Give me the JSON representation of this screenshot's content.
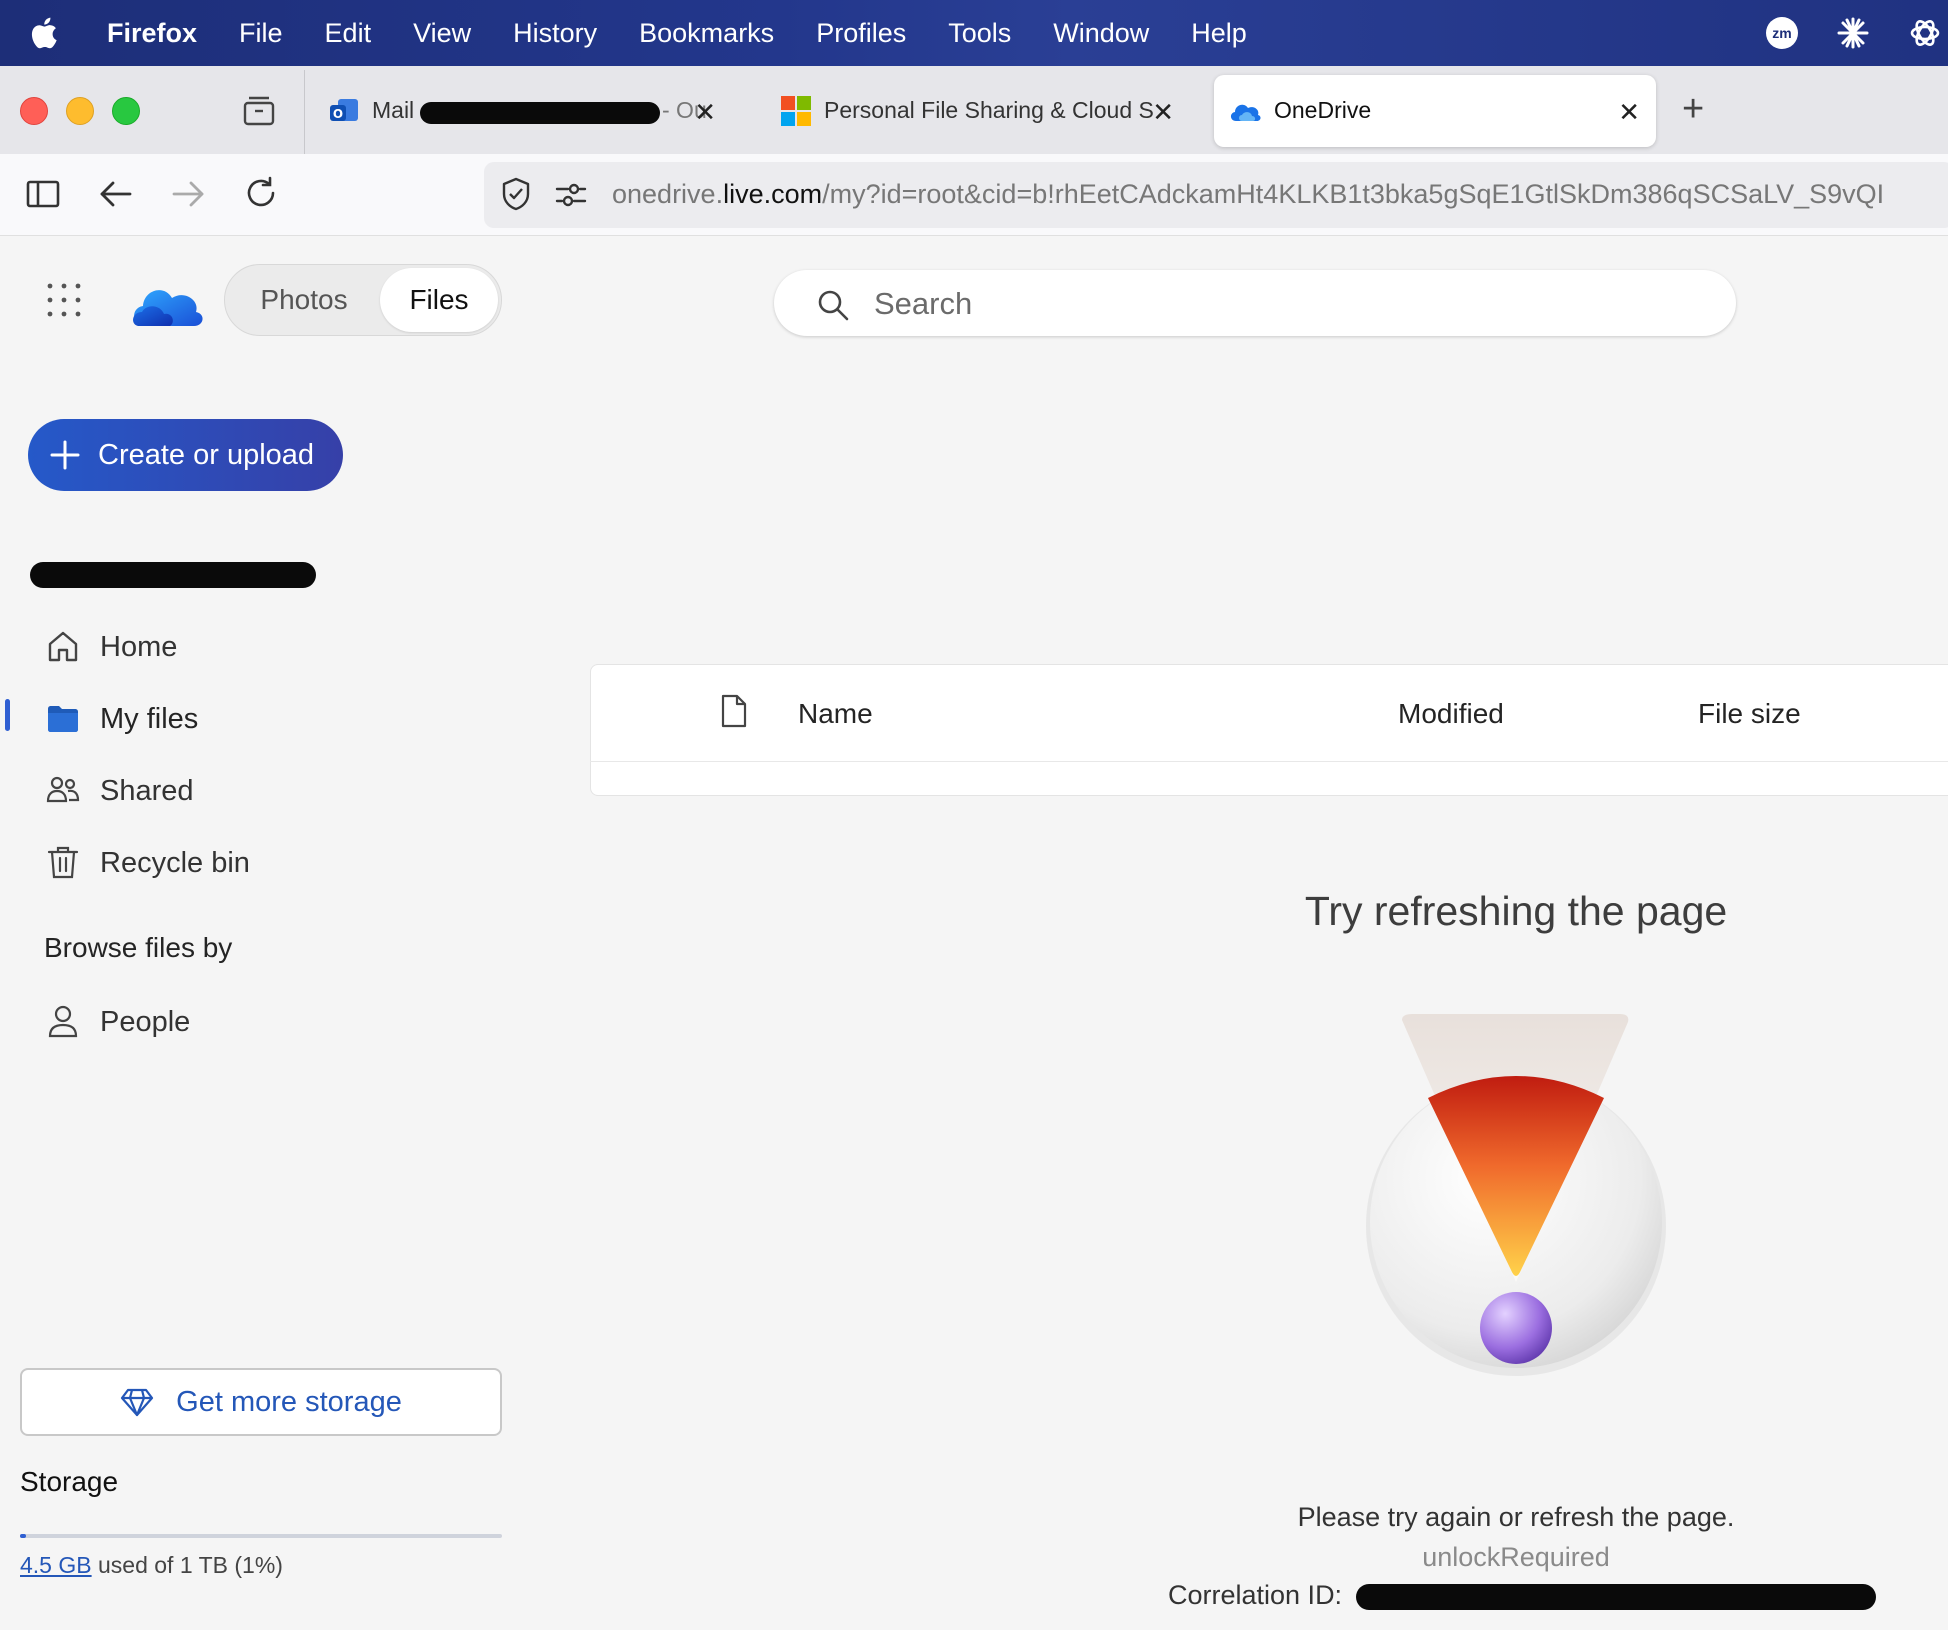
{
  "menubar": {
    "app_name": "Firefox",
    "items": [
      "File",
      "Edit",
      "View",
      "History",
      "Bookmarks",
      "Profiles",
      "Tools",
      "Window",
      "Help"
    ],
    "status_icons": [
      "zoom-icon",
      "claude-icon",
      "chatgpt-icon"
    ],
    "zoom_label": "zm"
  },
  "tabs": [
    {
      "title_prefix": "Mail -",
      "title_suffix": "- Ou",
      "icon": "outlook-icon",
      "active": false
    },
    {
      "title": "Personal File Sharing & Cloud St",
      "icon": "microsoft-icon",
      "active": false
    },
    {
      "title": "OneDrive",
      "icon": "onedrive-icon",
      "active": true
    }
  ],
  "address_bar": {
    "url_prefix": "onedrive.",
    "url_host": "live.com",
    "url_path": "/my?id=root&cid=b!rhEetCAdckamHt4KLKB1t3bka5gSqE1GtlSkDm386qSCSaLV_S9vQI"
  },
  "header": {
    "toggle_photos": "Photos",
    "toggle_files": "Files",
    "selected_toggle": "Files",
    "search_placeholder": "Search"
  },
  "sidebar": {
    "create_label": "Create or upload",
    "nav": [
      {
        "label": "Home",
        "icon": "home-icon"
      },
      {
        "label": "My files",
        "icon": "folder-icon",
        "selected": true
      },
      {
        "label": "Shared",
        "icon": "people-icon"
      },
      {
        "label": "Recycle bin",
        "icon": "trash-icon"
      }
    ],
    "browse_heading": "Browse files by",
    "browse": [
      {
        "label": "People",
        "icon": "person-icon"
      }
    ],
    "get_storage_label": "Get more storage",
    "storage_heading": "Storage",
    "storage_used": "4.5 GB",
    "storage_rest": "used of 1 TB (1%)",
    "storage_fraction": 0.01
  },
  "file_table": {
    "columns": [
      "Name",
      "Modified",
      "File size"
    ]
  },
  "error": {
    "title": "Try refreshing the page",
    "message": "Please try again or refresh the page.",
    "code": "unlockRequired",
    "correlation_label": "Correlation ID:"
  },
  "colors": {
    "accent": "#2f5fd2",
    "create_button_start": "#2559c9",
    "create_button_end": "#3640a8",
    "menubar": "#23378c"
  }
}
